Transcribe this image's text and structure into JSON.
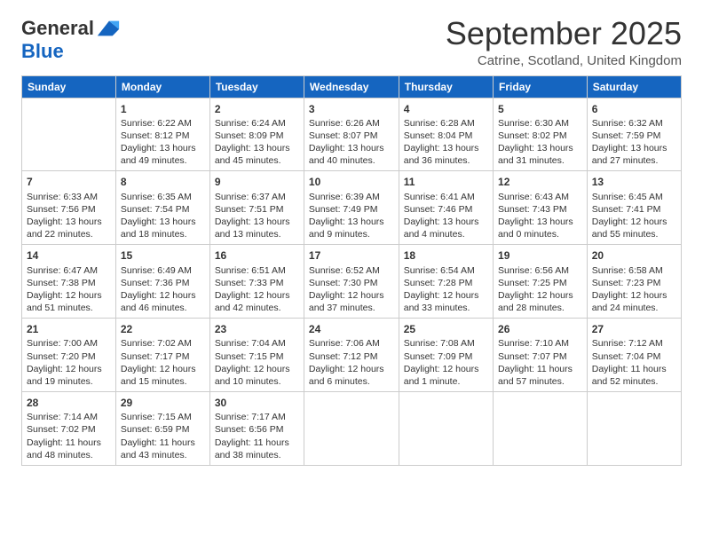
{
  "header": {
    "logo_general": "General",
    "logo_blue": "Blue",
    "month": "September 2025",
    "location": "Catrine, Scotland, United Kingdom"
  },
  "days_of_week": [
    "Sunday",
    "Monday",
    "Tuesday",
    "Wednesday",
    "Thursday",
    "Friday",
    "Saturday"
  ],
  "weeks": [
    [
      {
        "day": "",
        "info": ""
      },
      {
        "day": "1",
        "info": "Sunrise: 6:22 AM\nSunset: 8:12 PM\nDaylight: 13 hours and 49 minutes."
      },
      {
        "day": "2",
        "info": "Sunrise: 6:24 AM\nSunset: 8:09 PM\nDaylight: 13 hours and 45 minutes."
      },
      {
        "day": "3",
        "info": "Sunrise: 6:26 AM\nSunset: 8:07 PM\nDaylight: 13 hours and 40 minutes."
      },
      {
        "day": "4",
        "info": "Sunrise: 6:28 AM\nSunset: 8:04 PM\nDaylight: 13 hours and 36 minutes."
      },
      {
        "day": "5",
        "info": "Sunrise: 6:30 AM\nSunset: 8:02 PM\nDaylight: 13 hours and 31 minutes."
      },
      {
        "day": "6",
        "info": "Sunrise: 6:32 AM\nSunset: 7:59 PM\nDaylight: 13 hours and 27 minutes."
      }
    ],
    [
      {
        "day": "7",
        "info": "Sunrise: 6:33 AM\nSunset: 7:56 PM\nDaylight: 13 hours and 22 minutes."
      },
      {
        "day": "8",
        "info": "Sunrise: 6:35 AM\nSunset: 7:54 PM\nDaylight: 13 hours and 18 minutes."
      },
      {
        "day": "9",
        "info": "Sunrise: 6:37 AM\nSunset: 7:51 PM\nDaylight: 13 hours and 13 minutes."
      },
      {
        "day": "10",
        "info": "Sunrise: 6:39 AM\nSunset: 7:49 PM\nDaylight: 13 hours and 9 minutes."
      },
      {
        "day": "11",
        "info": "Sunrise: 6:41 AM\nSunset: 7:46 PM\nDaylight: 13 hours and 4 minutes."
      },
      {
        "day": "12",
        "info": "Sunrise: 6:43 AM\nSunset: 7:43 PM\nDaylight: 13 hours and 0 minutes."
      },
      {
        "day": "13",
        "info": "Sunrise: 6:45 AM\nSunset: 7:41 PM\nDaylight: 12 hours and 55 minutes."
      }
    ],
    [
      {
        "day": "14",
        "info": "Sunrise: 6:47 AM\nSunset: 7:38 PM\nDaylight: 12 hours and 51 minutes."
      },
      {
        "day": "15",
        "info": "Sunrise: 6:49 AM\nSunset: 7:36 PM\nDaylight: 12 hours and 46 minutes."
      },
      {
        "day": "16",
        "info": "Sunrise: 6:51 AM\nSunset: 7:33 PM\nDaylight: 12 hours and 42 minutes."
      },
      {
        "day": "17",
        "info": "Sunrise: 6:52 AM\nSunset: 7:30 PM\nDaylight: 12 hours and 37 minutes."
      },
      {
        "day": "18",
        "info": "Sunrise: 6:54 AM\nSunset: 7:28 PM\nDaylight: 12 hours and 33 minutes."
      },
      {
        "day": "19",
        "info": "Sunrise: 6:56 AM\nSunset: 7:25 PM\nDaylight: 12 hours and 28 minutes."
      },
      {
        "day": "20",
        "info": "Sunrise: 6:58 AM\nSunset: 7:23 PM\nDaylight: 12 hours and 24 minutes."
      }
    ],
    [
      {
        "day": "21",
        "info": "Sunrise: 7:00 AM\nSunset: 7:20 PM\nDaylight: 12 hours and 19 minutes."
      },
      {
        "day": "22",
        "info": "Sunrise: 7:02 AM\nSunset: 7:17 PM\nDaylight: 12 hours and 15 minutes."
      },
      {
        "day": "23",
        "info": "Sunrise: 7:04 AM\nSunset: 7:15 PM\nDaylight: 12 hours and 10 minutes."
      },
      {
        "day": "24",
        "info": "Sunrise: 7:06 AM\nSunset: 7:12 PM\nDaylight: 12 hours and 6 minutes."
      },
      {
        "day": "25",
        "info": "Sunrise: 7:08 AM\nSunset: 7:09 PM\nDaylight: 12 hours and 1 minute."
      },
      {
        "day": "26",
        "info": "Sunrise: 7:10 AM\nSunset: 7:07 PM\nDaylight: 11 hours and 57 minutes."
      },
      {
        "day": "27",
        "info": "Sunrise: 7:12 AM\nSunset: 7:04 PM\nDaylight: 11 hours and 52 minutes."
      }
    ],
    [
      {
        "day": "28",
        "info": "Sunrise: 7:14 AM\nSunset: 7:02 PM\nDaylight: 11 hours and 48 minutes."
      },
      {
        "day": "29",
        "info": "Sunrise: 7:15 AM\nSunset: 6:59 PM\nDaylight: 11 hours and 43 minutes."
      },
      {
        "day": "30",
        "info": "Sunrise: 7:17 AM\nSunset: 6:56 PM\nDaylight: 11 hours and 38 minutes."
      },
      {
        "day": "",
        "info": ""
      },
      {
        "day": "",
        "info": ""
      },
      {
        "day": "",
        "info": ""
      },
      {
        "day": "",
        "info": ""
      }
    ]
  ]
}
